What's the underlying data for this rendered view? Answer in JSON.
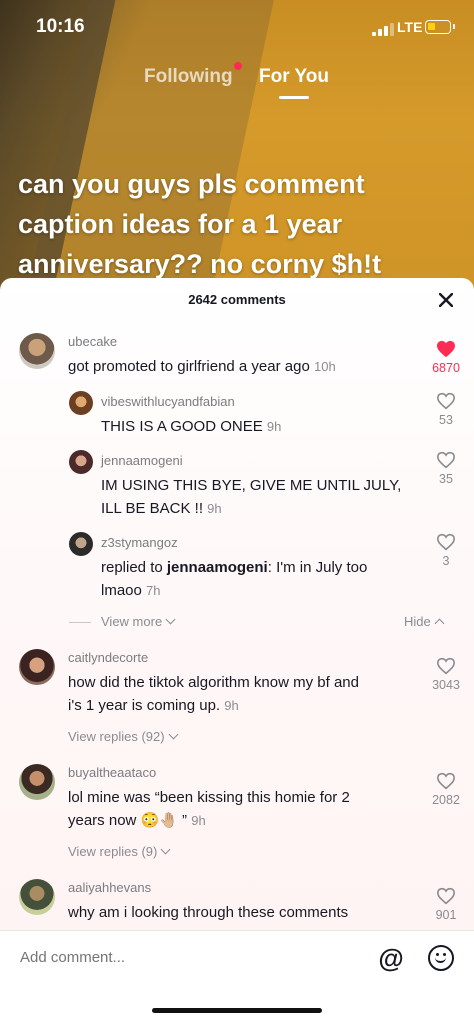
{
  "status_bar": {
    "time": "10:16",
    "network": "LTE"
  },
  "tabs": {
    "following": "Following",
    "for_you": "For You"
  },
  "caption": {
    "lines": [
      "can you guys pls comment",
      "caption ideas for a 1 year",
      "anniversary?? no corny $h!t"
    ]
  },
  "comments_panel": {
    "count_label": "2642 comments",
    "close_icon": "close-icon",
    "comments": [
      {
        "username": "ubecake",
        "text": "got promoted to girlfriend a year ago",
        "time": "10h",
        "likes": "6870",
        "liked": true
      },
      {
        "username": "vibeswithlucyandfabian",
        "text": "THIS IS A GOOD ONEE",
        "time": "9h",
        "likes": "53"
      },
      {
        "username": "jennaamogeni",
        "text_line1": "IM USING THIS BYE, GIVE ME UNTIL JULY,",
        "text_line2": "ILL BE BACK !!",
        "time": "9h",
        "likes": "35"
      },
      {
        "username": "z3stymangoz",
        "reply_prefix": "replied to ",
        "reply_to": "jennaamogeni",
        "reply_colon": ":",
        "text_line1": " I'm in July too",
        "text_line2": "lmaoo",
        "time": "7h",
        "likes": "3"
      },
      {
        "username": "caitlyndecorte",
        "text_line1": "how did the tiktok algorithm know my bf and",
        "text_line2": "i's 1 year is coming up.",
        "time": "9h",
        "likes": "3043"
      },
      {
        "username": "buyaltheaataco",
        "text_line1": "lol mine was “been kissing this homie for 2",
        "text_line2": "years now 😳🤚🏼 ”",
        "time": "9h",
        "likes": "2082"
      },
      {
        "username": "aaliyahhevans",
        "text": "why am i looking through these comments",
        "likes": "901"
      }
    ],
    "view_more": "View more",
    "hide": "Hide",
    "view_replies_1": "View replies (92)",
    "view_replies_2": "View replies (9)"
  },
  "add_comment": {
    "placeholder": "Add comment...",
    "mention_symbol": "@"
  },
  "colors": {
    "accent": "#fe2c55",
    "text": "#161823",
    "muted": "#8a8b91"
  }
}
